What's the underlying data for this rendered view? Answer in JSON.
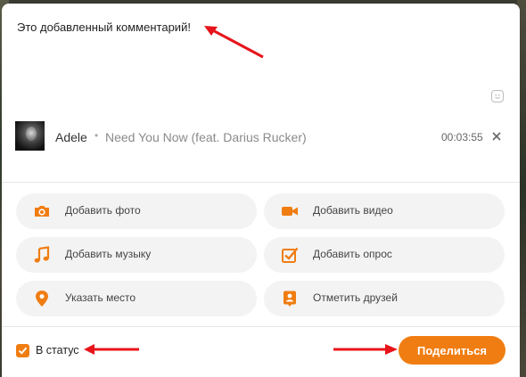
{
  "composer": {
    "comment_text": "Это добавленный комментарий!",
    "emoji_icon": "smiley-icon"
  },
  "attached_track": {
    "artist": "Adele",
    "separator": "•",
    "title": "Need You Now (feat. Darius Rucker)",
    "duration": "00:03:55"
  },
  "actions": [
    {
      "label": "Добавить фото",
      "icon": "camera-icon"
    },
    {
      "label": "Добавить видео",
      "icon": "video-camera-icon"
    },
    {
      "label": "Добавить музыку",
      "icon": "music-note-icon"
    },
    {
      "label": "Добавить опрос",
      "icon": "poll-checkbox-icon"
    },
    {
      "label": "Указать место",
      "icon": "location-pin-icon"
    },
    {
      "label": "Отметить друзей",
      "icon": "tag-friend-icon"
    }
  ],
  "footer": {
    "status_checkbox_label": "В статус",
    "status_checked": true,
    "share_label": "Поделиться"
  },
  "colors": {
    "accent": "#f07d12",
    "annotation_arrow": "#e8141b"
  }
}
